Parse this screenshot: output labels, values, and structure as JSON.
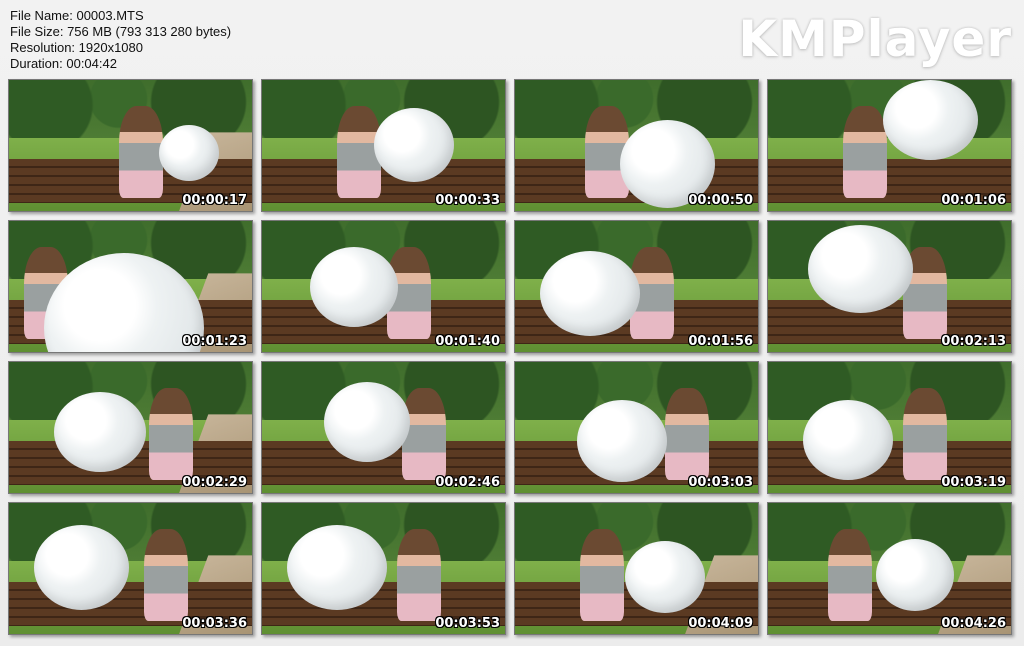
{
  "file_info": {
    "file_name": "File Name: 00003.MTS",
    "file_size": "File Size: 756 MB (793 313 280 bytes)",
    "resolution": "Resolution: 1920x1080",
    "duration": "Duration: 00:04:42"
  },
  "brand": "KMPlayer",
  "thumbnails": [
    {
      "time": "00:00:17"
    },
    {
      "time": "00:00:33"
    },
    {
      "time": "00:00:50"
    },
    {
      "time": "00:01:06"
    },
    {
      "time": "00:01:23"
    },
    {
      "time": "00:01:40"
    },
    {
      "time": "00:01:56"
    },
    {
      "time": "00:02:13"
    },
    {
      "time": "00:02:29"
    },
    {
      "time": "00:02:46"
    },
    {
      "time": "00:03:03"
    },
    {
      "time": "00:03:19"
    },
    {
      "time": "00:03:36"
    },
    {
      "time": "00:03:53"
    },
    {
      "time": "00:04:09"
    },
    {
      "time": "00:04:26"
    }
  ]
}
